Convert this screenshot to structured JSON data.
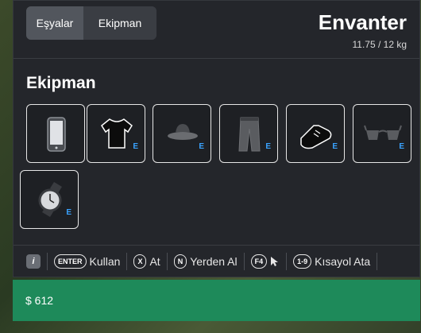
{
  "tabs": [
    {
      "label": "Eşyalar"
    },
    {
      "label": "Ekipman"
    }
  ],
  "header": {
    "title": "Envanter",
    "weight": "11.75 / 12 kg"
  },
  "section": {
    "title": "Ekipman"
  },
  "slots": [
    {
      "icon": "phone-icon",
      "tag": ""
    },
    {
      "icon": "shirt-icon",
      "tag": "E"
    },
    {
      "icon": "hat-icon",
      "tag": "E"
    },
    {
      "icon": "pants-icon",
      "tag": "E"
    },
    {
      "icon": "shoe-icon",
      "tag": "E"
    },
    {
      "icon": "glasses-icon",
      "tag": "E"
    },
    {
      "icon": "watch-icon",
      "tag": "E"
    }
  ],
  "hints": [
    {
      "key": "i"
    },
    {
      "key": "ENTER",
      "label": "Kullan"
    },
    {
      "key": "X",
      "label": "At"
    },
    {
      "key": "N",
      "label": "Yerden Al"
    },
    {
      "key": "F4"
    },
    {
      "key": "1-9",
      "label": "Kısayol Ata"
    }
  ],
  "money": {
    "label": "$ 612"
  },
  "colors": {
    "panel": "#24262b",
    "money_bar": "#1e8a5a",
    "equip_tag": "#3aa3ff"
  }
}
